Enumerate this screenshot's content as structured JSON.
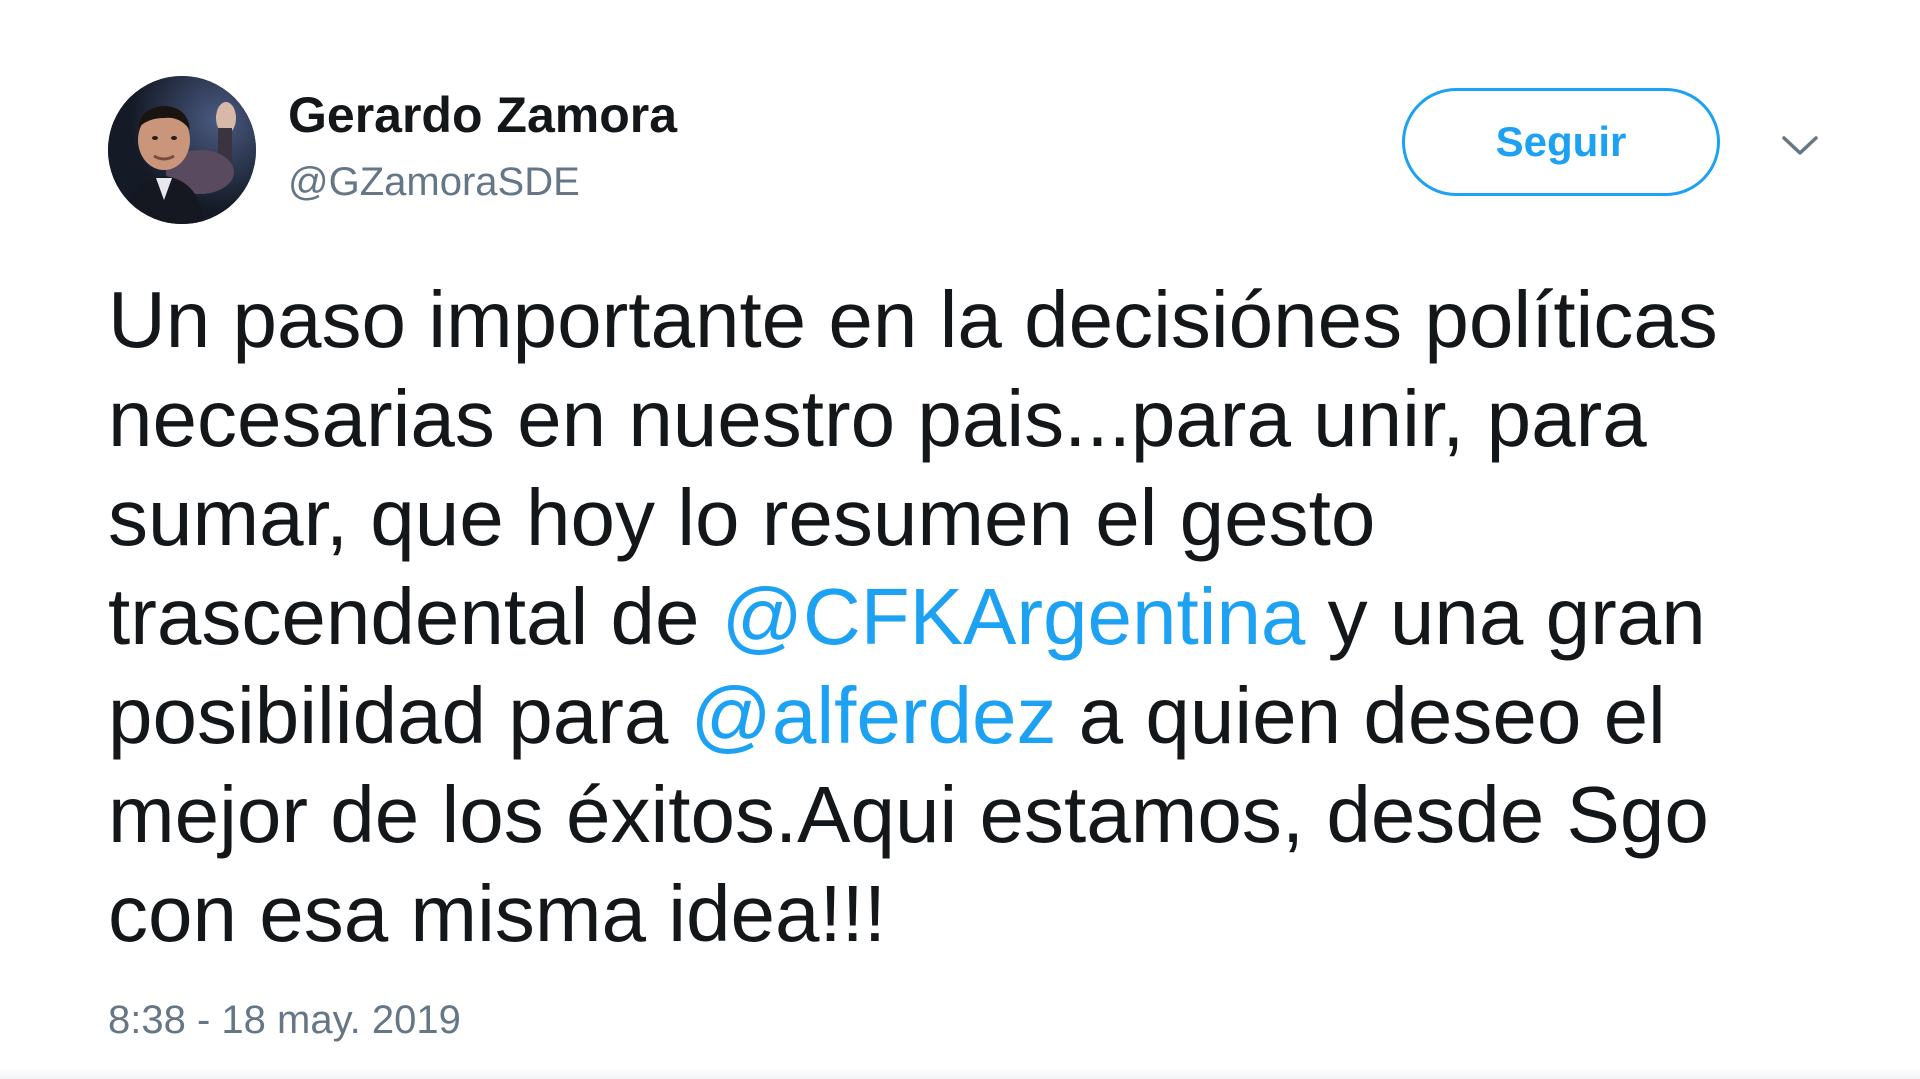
{
  "author": {
    "display_name": "Gerardo Zamora",
    "handle": "@GZamoraSDE",
    "avatar_icon": "user-avatar-photo"
  },
  "follow_button": {
    "label": "Seguir",
    "color": "#1da1f2"
  },
  "more_menu": {
    "icon": "chevron-down-icon"
  },
  "tweet": {
    "line1": "Un paso importante en la decisiónes políticas",
    "line2": "necesarias en nuestro pais...para unir, para",
    "line3": "sumar, que hoy lo resumen el gesto",
    "line4_before": "trascendental de ",
    "mention1": "@CFKArgentina",
    "line4_after": " y una gran",
    "line5_before": "posibilidad para ",
    "mention2": "@alferdez",
    "line5_after": " a quien deseo el",
    "line6": "mejor de los éxitos.Aqui estamos, desde Sgo",
    "line7": "con esa misma idea!!!"
  },
  "timestamp": "8:38 - 18 may. 2019",
  "colors": {
    "text": "#14171a",
    "secondary": "#657786",
    "link": "#1da1f2"
  }
}
